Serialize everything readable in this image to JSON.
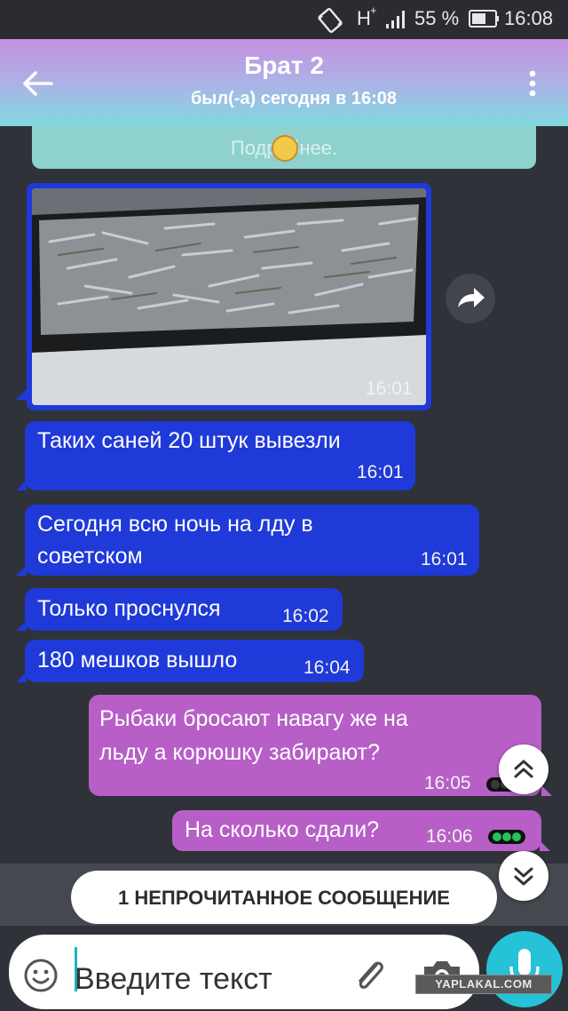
{
  "status_bar": {
    "network": "H",
    "network_plus": "+",
    "battery_percent": "55 %",
    "time": "16:08"
  },
  "header": {
    "title": "Брат 2",
    "subtitle": "был(-а) сегодня в 16:08",
    "gradient_top": "#c78fe0",
    "gradient_bottom": "#7fd8df"
  },
  "notice": {
    "text": "Подробнее."
  },
  "photo_message": {
    "time": "16:01"
  },
  "messages": [
    {
      "direction": "in",
      "text": "Таких саней 20 штук вывезли",
      "time": "16:01"
    },
    {
      "direction": "in",
      "text": "Сегодня всю ночь на лду в\nсоветском",
      "time": "16:01"
    },
    {
      "direction": "in",
      "text": "Только проснулся",
      "time": "16:02"
    },
    {
      "direction": "in",
      "text": "180 мешков вышло",
      "time": "16:04"
    },
    {
      "direction": "out",
      "text": "Рыбаки бросают навагу же на\nльду а корюшку забирают?",
      "time": "16:05"
    },
    {
      "direction": "out",
      "text": "На сколько сдали?",
      "time": "16:06"
    }
  ],
  "colors": {
    "incoming_bubble": "#1f3ad8",
    "outgoing_bubble": "#b75fc7",
    "accent": "#25c2d8",
    "read_indicator": "#23c35a"
  },
  "unread_banner": {
    "text": "1 НЕПРОЧИТАННОЕ СООБЩЕНИЕ"
  },
  "composer": {
    "placeholder": "Введите текст"
  },
  "watermark": "YAPLAKAL.COM",
  "icons": [
    "back-arrow-icon",
    "more-vert-icon",
    "forward-icon",
    "chevron-up-icon",
    "chevron-down-icon",
    "emoji-icon",
    "paperclip-icon",
    "camera-icon",
    "microphone-icon"
  ]
}
